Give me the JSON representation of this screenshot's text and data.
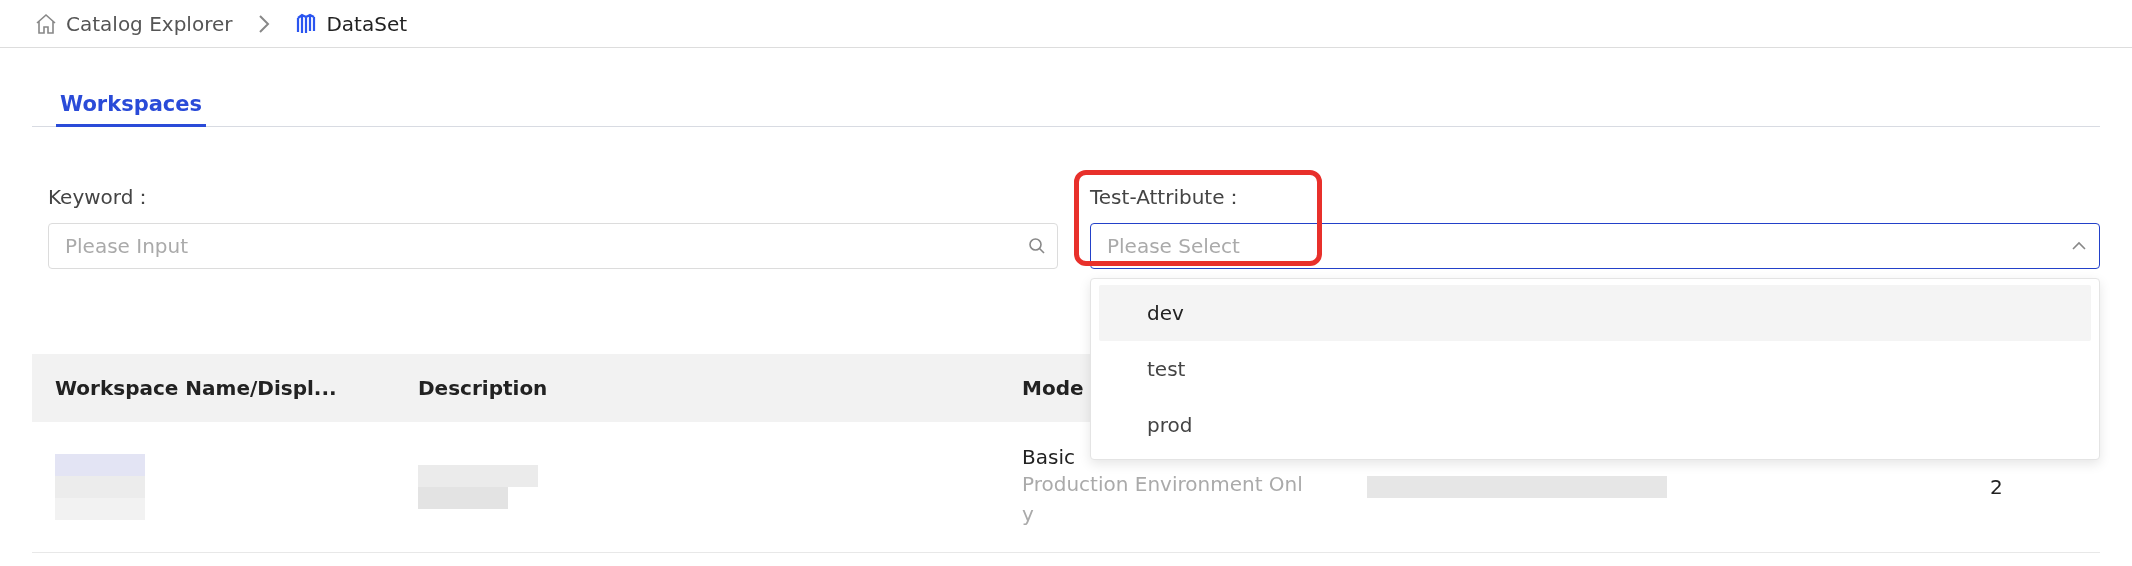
{
  "breadcrumb": [
    {
      "label": "Catalog Explorer"
    },
    {
      "label": "DataSet"
    }
  ],
  "tabs": [
    {
      "label": "Workspaces",
      "selected": true
    }
  ],
  "filters": [
    {
      "label": "Keyword：",
      "kind": "input",
      "placeholder": "Please Input"
    },
    {
      "label": "Test-Attribute：",
      "kind": "select",
      "placeholder": "Please Select",
      "expanded": true,
      "highlighted": true,
      "options": [
        {
          "label": "dev",
          "hovered": true
        },
        {
          "label": "test",
          "hovered": false
        },
        {
          "label": "prod",
          "hovered": false
        }
      ]
    }
  ],
  "table": {
    "columns": [
      "Workspace Name/Displ...",
      "Description",
      "Mode"
    ],
    "rows": [
      {
        "mode": "Basic",
        "mode_detail": "Production Environment Only",
        "column_5": "2"
      }
    ]
  }
}
